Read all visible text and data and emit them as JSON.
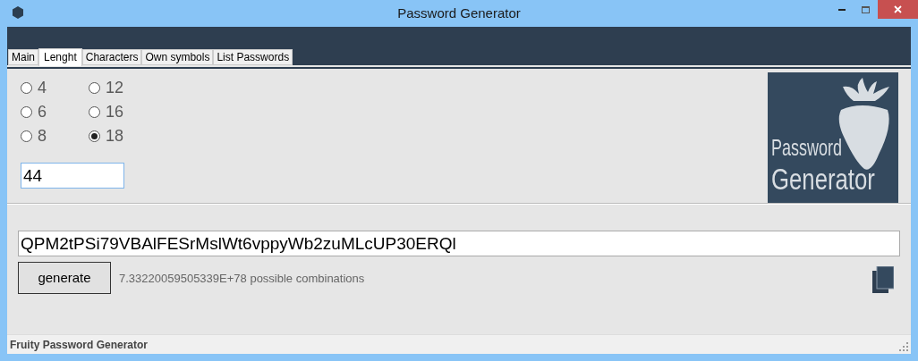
{
  "window": {
    "title": "Password Generator"
  },
  "tabs": [
    {
      "label": "Main",
      "selected": false
    },
    {
      "label": "Lenght",
      "selected": true
    },
    {
      "label": "Characters",
      "selected": false
    },
    {
      "label": "Own symbols",
      "selected": false
    },
    {
      "label": "List Passwords",
      "selected": false
    }
  ],
  "length_options": [
    {
      "label": "4",
      "selected": false
    },
    {
      "label": "6",
      "selected": false
    },
    {
      "label": "8",
      "selected": false
    },
    {
      "label": "12",
      "selected": false
    },
    {
      "label": "16",
      "selected": false
    },
    {
      "label": "18",
      "selected": true
    }
  ],
  "custom_length": {
    "value": "44"
  },
  "logo": {
    "line_1": "Password",
    "line_2": "Generator"
  },
  "password": {
    "value": "QPM2tPSi79VBAlFESrMslWt6vppyWb2zuMLcUP30ERQl"
  },
  "generate_button": "generate",
  "combinations": "7.33220059505339E+78 possible combinations",
  "status_bar": "Fruity Password Generator"
}
